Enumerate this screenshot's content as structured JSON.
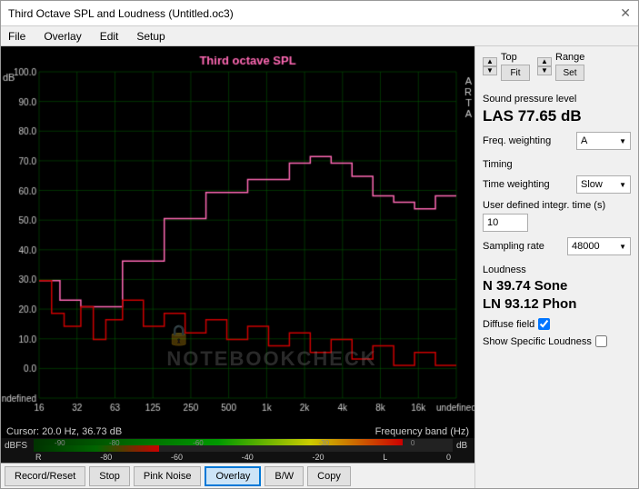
{
  "window": {
    "title": "Third Octave SPL and Loudness (Untitled.oc3)",
    "close_label": "✕"
  },
  "menu": {
    "items": [
      "File",
      "Overlay",
      "Edit",
      "Setup"
    ]
  },
  "chart": {
    "title": "Third octave SPL",
    "y_label": "dB",
    "arta_lines": [
      "A",
      "R",
      "T",
      "A"
    ],
    "cursor_text": "Cursor:  20.0 Hz, 36.73 dB",
    "freq_band_text": "Frequency band (Hz)",
    "x_labels": [
      "16",
      "32",
      "63",
      "125",
      "250",
      "500",
      "1k",
      "2k",
      "4k",
      "8k",
      "16k"
    ],
    "y_labels": [
      "100.0",
      "90.0",
      "80.0",
      "70.0",
      "60.0",
      "50.0",
      "40.0",
      "30.0",
      "20.0",
      "10.0",
      "0.0"
    ]
  },
  "top_controls": {
    "top_label": "Top",
    "fit_label": "Fit",
    "range_label": "Range",
    "set_label": "Set"
  },
  "sidebar": {
    "spl_section": "Sound pressure level",
    "spl_value": "LAS 77.65 dB",
    "freq_weighting_label": "Freq. weighting",
    "freq_weighting_value": "A",
    "timing_section": "Timing",
    "time_weighting_label": "Time weighting",
    "time_weighting_value": "Slow",
    "user_integr_label": "User defined integr. time (s)",
    "user_integr_value": "10",
    "sampling_rate_label": "Sampling rate",
    "sampling_rate_value": "48000",
    "loudness_section": "Loudness",
    "loudness_value1": "N 39.74 Sone",
    "loudness_value2": "LN 93.12 Phon",
    "diffuse_field_label": "Diffuse field",
    "show_specific_label": "Show Specific Loudness"
  },
  "meter": {
    "left_label": "dBFS",
    "right_label": "dB",
    "channel_r": "R",
    "channel_l": "L",
    "ticks": [
      "-90",
      "-80",
      "-60",
      "-30",
      "0"
    ],
    "ticks2": [
      "-80",
      "-60",
      "-40",
      "-20",
      "0"
    ]
  },
  "buttons": {
    "record_reset": "Record/Reset",
    "stop": "Stop",
    "pink_noise": "Pink Noise",
    "overlay": "Overlay",
    "bw": "B/W",
    "copy": "Copy"
  },
  "colors": {
    "bg": "#000000",
    "grid": "#006600",
    "pink_curve": "#ff69b4",
    "red_curve": "#cc0000",
    "accent": "#0078d7"
  }
}
